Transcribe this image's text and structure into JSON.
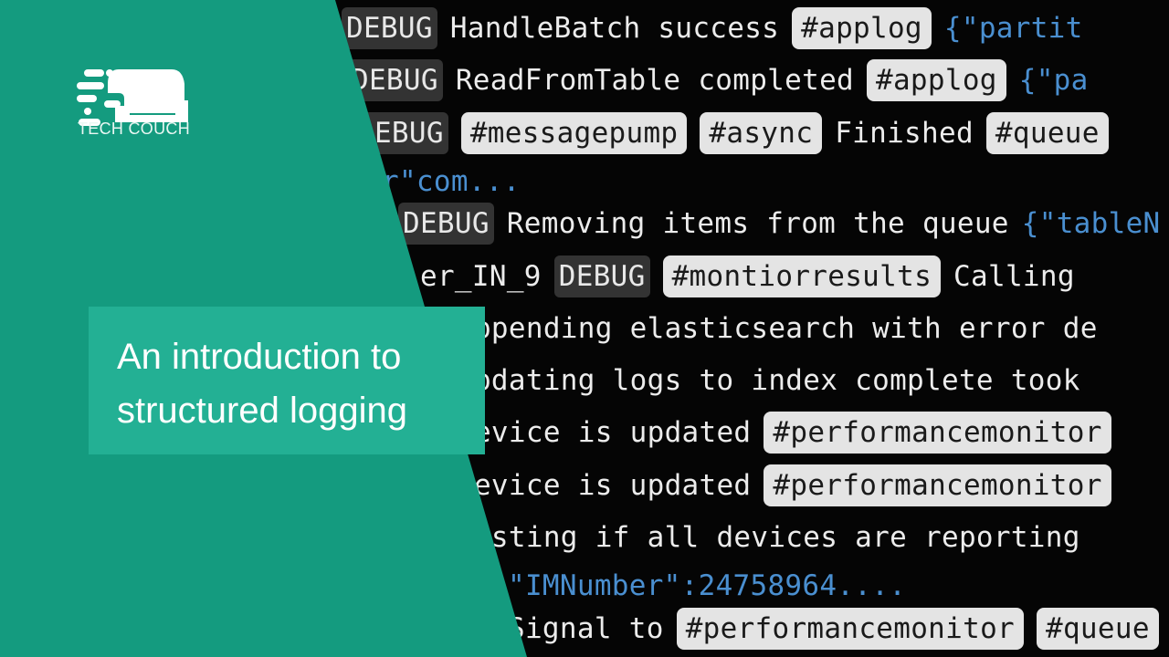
{
  "brand": {
    "name": "TECH COUCH",
    "logo_icon": "couch-speed-icon"
  },
  "title": {
    "line1": "An introduction to",
    "line2": "structured logging"
  },
  "colors": {
    "panel": "#149b7f",
    "title_box": "#23b094",
    "log_bg": "#050505",
    "json_text": "#4a8fd0",
    "tag_bg": "#e4e4e4",
    "level_bg": "#333333"
  },
  "log_lines": [
    {
      "parts": [
        {
          "t": "lvl",
          "v": "DEBUG"
        },
        {
          "t": "txt",
          "v": "HandleBatch success"
        },
        {
          "t": "tag",
          "v": "#applog"
        },
        {
          "t": "json",
          "v": "{\"partit"
        }
      ]
    },
    {
      "parts": [
        {
          "t": "lvl",
          "v": "DEBUG"
        },
        {
          "t": "txt",
          "v": "ReadFromTable completed"
        },
        {
          "t": "tag",
          "v": "#applog"
        },
        {
          "t": "json",
          "v": "{\"pa"
        }
      ]
    },
    {
      "parts": [
        {
          "t": "lvl",
          "v": "DEBUG"
        },
        {
          "t": "tag",
          "v": "#messagepump"
        },
        {
          "t": "tag",
          "v": "#async"
        },
        {
          "t": "txt",
          "v": "Finished"
        },
        {
          "t": "tag",
          "v": "#queue"
        }
      ]
    },
    {
      "parts": [
        {
          "t": "json",
          "v": "r\"com..."
        }
      ]
    },
    {
      "parts": [
        {
          "t": "lvl",
          "v": "DEBUG"
        },
        {
          "t": "txt",
          "v": "Removing items from the queue"
        },
        {
          "t": "json",
          "v": "{\"tableN"
        }
      ]
    },
    {
      "parts": [
        {
          "t": "txt",
          "v": "er_IN_9"
        },
        {
          "t": "lvl",
          "v": "DEBUG"
        },
        {
          "t": "tag",
          "v": "#montiorresults"
        },
        {
          "t": "txt",
          "v": "Calling"
        }
      ]
    },
    {
      "parts": [
        {
          "t": "txt",
          "v": "Appending elasticsearch with error de"
        }
      ]
    },
    {
      "parts": [
        {
          "t": "txt",
          "v": "Updating logs to index complete took"
        }
      ]
    },
    {
      "parts": [
        {
          "t": "txt",
          "v": "Device is updated"
        },
        {
          "t": "tag",
          "v": "#performancemonitor"
        }
      ]
    },
    {
      "parts": [
        {
          "t": "txt",
          "v": "Device is updated"
        },
        {
          "t": "tag",
          "v": "#performancemonitor"
        }
      ]
    },
    {
      "parts": [
        {
          "t": "txt",
          "v": "Testing if all devices are reporting"
        }
      ]
    },
    {
      "parts": [
        {
          "t": "json",
          "v": "\"IMNumber\":24758964...."
        }
      ]
    },
    {
      "parts": [
        {
          "t": "txt",
          "v": "Signal to"
        },
        {
          "t": "tag",
          "v": "#performancemonitor"
        },
        {
          "t": "tag",
          "v": "#queue"
        }
      ]
    }
  ]
}
